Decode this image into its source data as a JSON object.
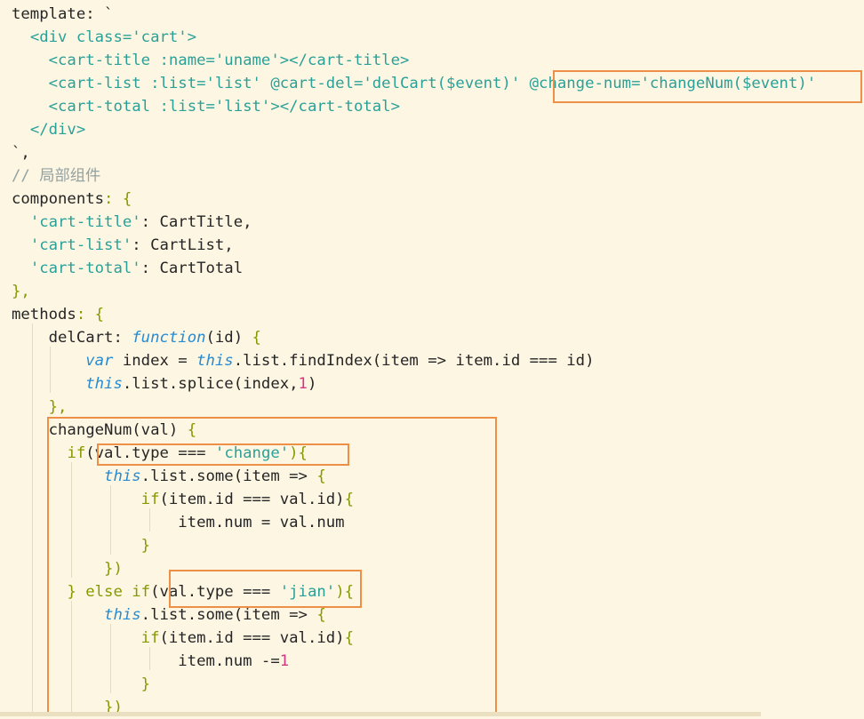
{
  "code": {
    "lines": [
      [
        {
          "t": "template: `",
          "c": ""
        }
      ],
      [
        {
          "t": "  ",
          "c": ""
        },
        {
          "t": "<div class='cart'>",
          "c": "s"
        }
      ],
      [
        {
          "t": "    ",
          "c": ""
        },
        {
          "t": "<cart-title :name='uname'></cart-title>",
          "c": "s"
        }
      ],
      [
        {
          "t": "    ",
          "c": ""
        },
        {
          "t": "<cart-list :list='list' @cart-del='delCart($event)' @change-num='changeNum($event)'",
          "c": "s"
        }
      ],
      [
        {
          "t": "    ",
          "c": ""
        },
        {
          "t": "<cart-total :list='list'></cart-total>",
          "c": "s"
        }
      ],
      [
        {
          "t": "  ",
          "c": ""
        },
        {
          "t": "</div>",
          "c": "s"
        }
      ],
      [
        {
          "t": "`,",
          "c": ""
        }
      ],
      [
        {
          "t": "// 局部组件",
          "c": "c"
        }
      ],
      [
        {
          "t": "components",
          "c": ""
        },
        {
          "t": ": {",
          "c": "p"
        }
      ],
      [
        {
          "t": "  ",
          "c": ""
        },
        {
          "t": "'cart-title'",
          "c": "s"
        },
        {
          "t": ": CartTitle,",
          "c": ""
        }
      ],
      [
        {
          "t": "  ",
          "c": ""
        },
        {
          "t": "'cart-list'",
          "c": "s"
        },
        {
          "t": ": CartList,",
          "c": ""
        }
      ],
      [
        {
          "t": "  ",
          "c": ""
        },
        {
          "t": "'cart-total'",
          "c": "s"
        },
        {
          "t": ": CartTotal",
          "c": ""
        }
      ],
      [
        {
          "t": "},",
          "c": "p"
        }
      ],
      [
        {
          "t": "methods",
          "c": ""
        },
        {
          "t": ": {",
          "c": "p"
        }
      ],
      [
        {
          "t": "    delCart: ",
          "c": ""
        },
        {
          "t": "function",
          "c": "k"
        },
        {
          "t": "(id) ",
          "c": ""
        },
        {
          "t": "{",
          "c": "p"
        }
      ],
      [
        {
          "t": "        ",
          "c": ""
        },
        {
          "t": "var",
          "c": "k"
        },
        {
          "t": " index = ",
          "c": ""
        },
        {
          "t": "this",
          "c": "k"
        },
        {
          "t": ".list.findIndex(item => item.id === id)",
          "c": ""
        }
      ],
      [
        {
          "t": "        ",
          "c": ""
        },
        {
          "t": "this",
          "c": "k"
        },
        {
          "t": ".list.splice(index,",
          "c": ""
        },
        {
          "t": "1",
          "c": "n"
        },
        {
          "t": ")",
          "c": ""
        }
      ],
      [
        {
          "t": "    ",
          "c": ""
        },
        {
          "t": "},",
          "c": "p"
        }
      ],
      [
        {
          "t": "    changeNum(val) ",
          "c": ""
        },
        {
          "t": "{",
          "c": "p"
        }
      ],
      [
        {
          "t": "      ",
          "c": ""
        },
        {
          "t": "if",
          "c": "p"
        },
        {
          "t": "(val.type === ",
          "c": ""
        },
        {
          "t": "'change'",
          "c": "s"
        },
        {
          "t": "){",
          "c": "p"
        }
      ],
      [
        {
          "t": "          ",
          "c": ""
        },
        {
          "t": "this",
          "c": "k"
        },
        {
          "t": ".list.some(item => ",
          "c": ""
        },
        {
          "t": "{",
          "c": "p"
        }
      ],
      [
        {
          "t": "              ",
          "c": ""
        },
        {
          "t": "if",
          "c": "p"
        },
        {
          "t": "(item.id === val.id)",
          "c": ""
        },
        {
          "t": "{",
          "c": "p"
        }
      ],
      [
        {
          "t": "                  item.num = val.num",
          "c": ""
        }
      ],
      [
        {
          "t": "              ",
          "c": ""
        },
        {
          "t": "}",
          "c": "p"
        }
      ],
      [
        {
          "t": "          ",
          "c": ""
        },
        {
          "t": "})",
          "c": "p"
        }
      ],
      [
        {
          "t": "      ",
          "c": ""
        },
        {
          "t": "} else if",
          "c": "p"
        },
        {
          "t": "(val.type === ",
          "c": ""
        },
        {
          "t": "'jian'",
          "c": "s"
        },
        {
          "t": "){",
          "c": "p"
        }
      ],
      [
        {
          "t": "          ",
          "c": ""
        },
        {
          "t": "this",
          "c": "k"
        },
        {
          "t": ".list.some(item => ",
          "c": ""
        },
        {
          "t": "{",
          "c": "p"
        }
      ],
      [
        {
          "t": "              ",
          "c": ""
        },
        {
          "t": "if",
          "c": "p"
        },
        {
          "t": "(item.id === val.id)",
          "c": ""
        },
        {
          "t": "{",
          "c": "p"
        }
      ],
      [
        {
          "t": "                  item.num -=",
          "c": ""
        },
        {
          "t": "1",
          "c": "n"
        }
      ],
      [
        {
          "t": "              ",
          "c": ""
        },
        {
          "t": "}",
          "c": "p"
        }
      ],
      [
        {
          "t": "          ",
          "c": ""
        },
        {
          "t": "})",
          "c": "p"
        }
      ]
    ]
  },
  "colors": {
    "background": "#fdf6e3",
    "highlight_box": "#ee8f47",
    "string": "#2aa198",
    "keyword": "#268bd2",
    "number": "#d33682",
    "punctuation": "#859900",
    "comment": "#93a1a1"
  }
}
